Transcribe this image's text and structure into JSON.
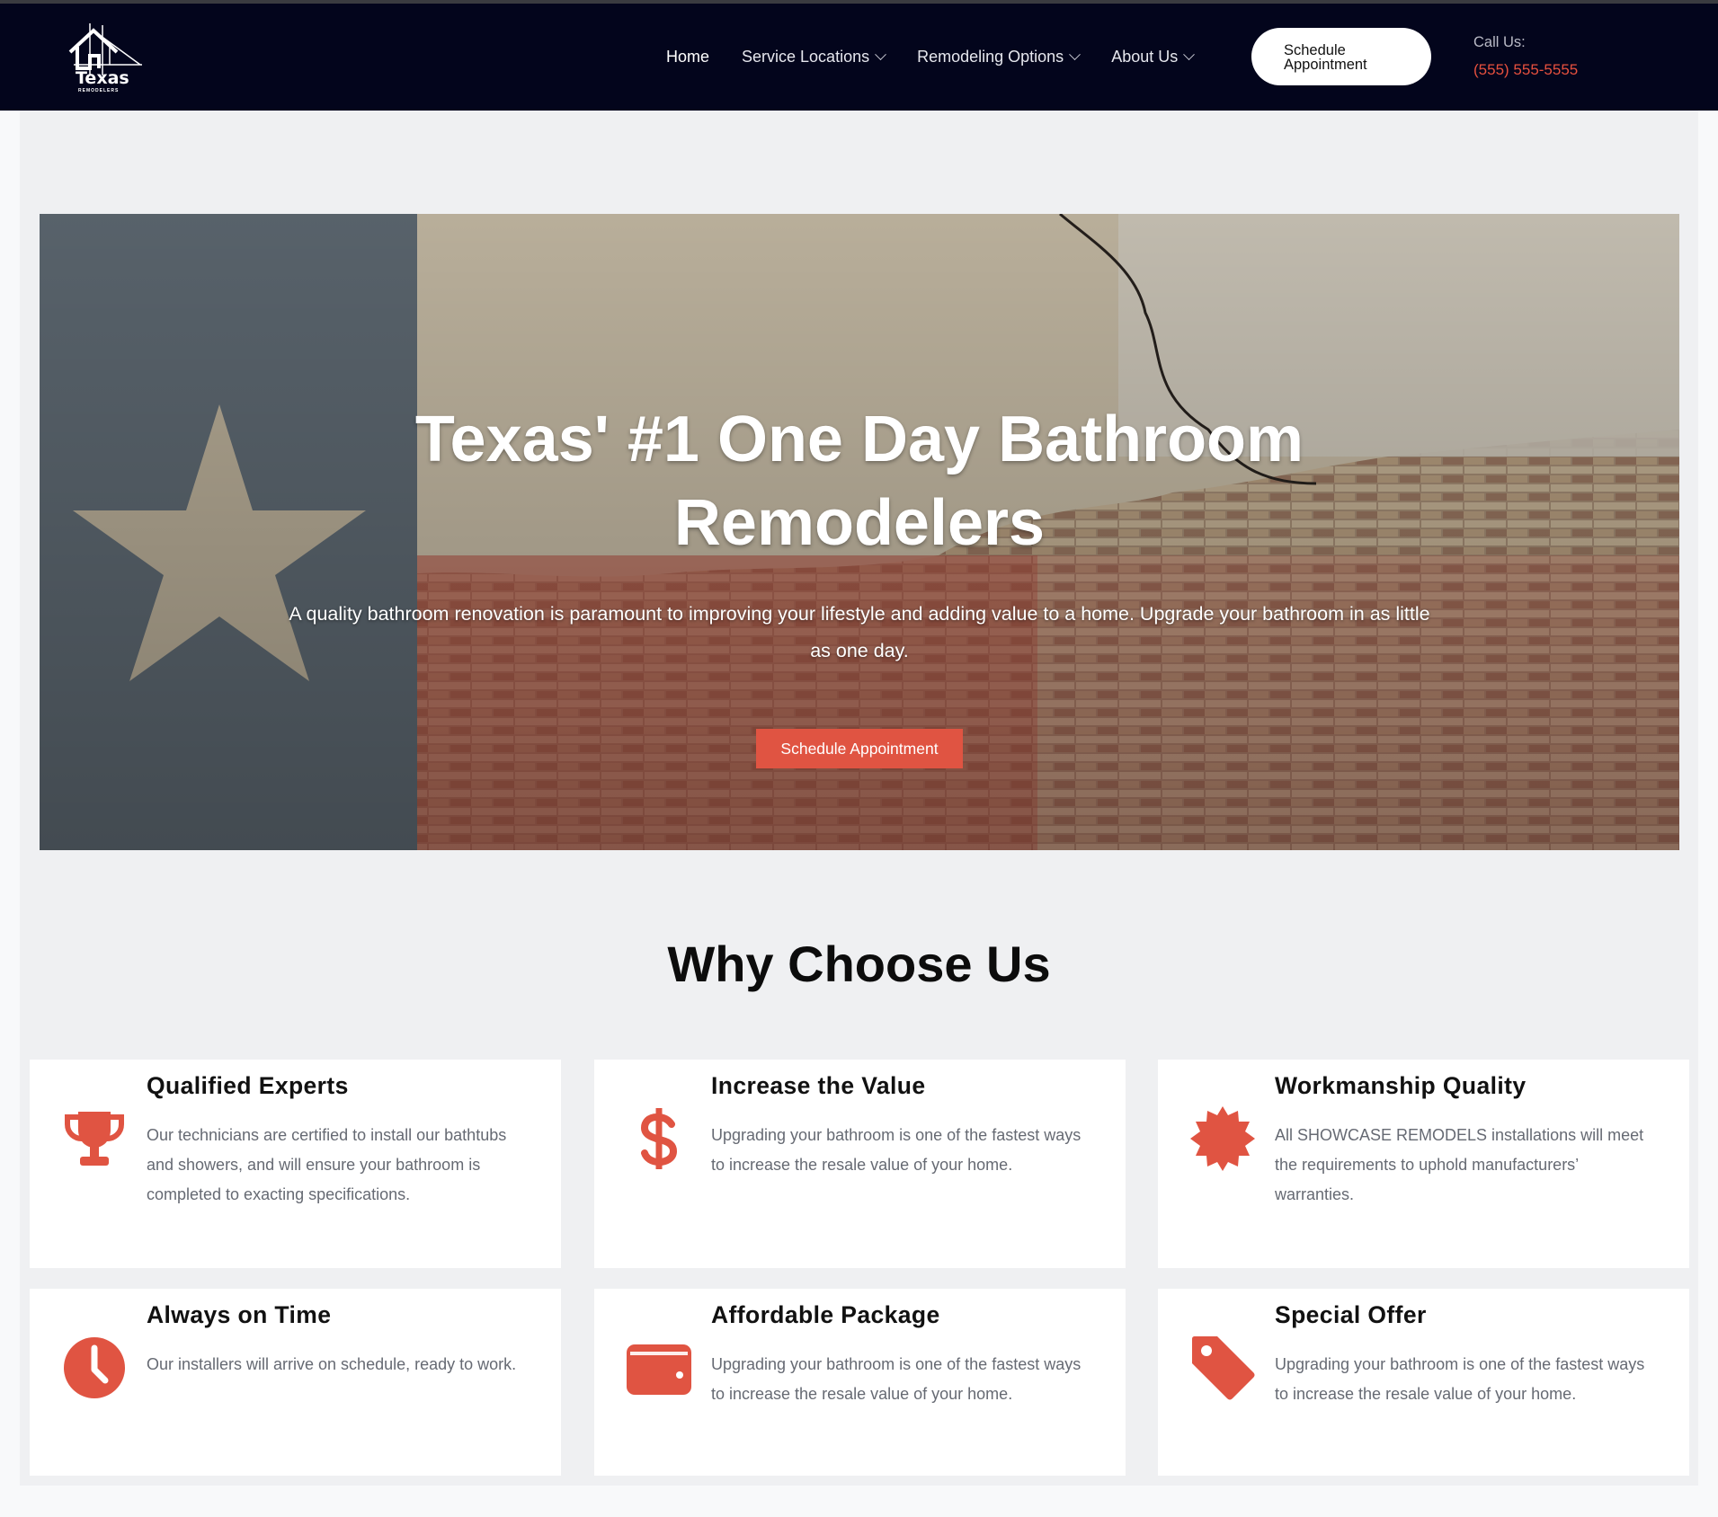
{
  "header": {
    "logo_text": "Texas",
    "logo_subtext": "REMODELERS",
    "nav": [
      {
        "label": "Home",
        "dropdown": false
      },
      {
        "label": "Service Locations",
        "dropdown": true
      },
      {
        "label": "Remodeling Options",
        "dropdown": true
      },
      {
        "label": "About Us",
        "dropdown": true
      }
    ],
    "cta_line1": "Schedule",
    "cta_line2": "Appointment",
    "call_label": "Call Us:",
    "call_phone": "(555) 555-5555"
  },
  "hero": {
    "title_line1": "Texas' #1 One Day Bathroom",
    "title_line2": "Remodelers",
    "subtitle": "A quality bathroom renovation is paramount to improving your lifestyle and adding value to a home.  Upgrade your bathroom in as little as one day.",
    "button": "Schedule Appointment"
  },
  "why": {
    "title": "Why Choose Us",
    "features": [
      {
        "title": "Qualified Experts",
        "text": "Our technicians are certified to install our bathtubs and showers, and will ensure your bathroom is completed to exacting specifications.",
        "icon": "trophy-icon"
      },
      {
        "title": "Increase the Value",
        "text": "Upgrading your bathroom is one of the fastest ways to increase the resale value of your home.",
        "icon": "dollar-icon"
      },
      {
        "title": "Workmanship Quality",
        "text": "All SHOWCASE REMODELS installations will meet the requirements to uphold manufacturers’ warranties.",
        "icon": "certificate-icon"
      },
      {
        "title": "Always on Time",
        "text": "Our installers will arrive on schedule, ready to work.",
        "icon": "clock-icon"
      },
      {
        "title": "Affordable Package",
        "text": "Upgrading your bathroom is one of the fastest ways to increase the resale value of your home.",
        "icon": "wallet-icon"
      },
      {
        "title": "Special Offer",
        "text": "Upgrading your bathroom is one of the fastest ways to increase the resale value of your home.",
        "icon": "tag-icon"
      }
    ]
  },
  "colors": {
    "header_bg": "#03051c",
    "accent": "#e05442",
    "phone": "#e6503e",
    "page_bg": "#eff0f2"
  }
}
